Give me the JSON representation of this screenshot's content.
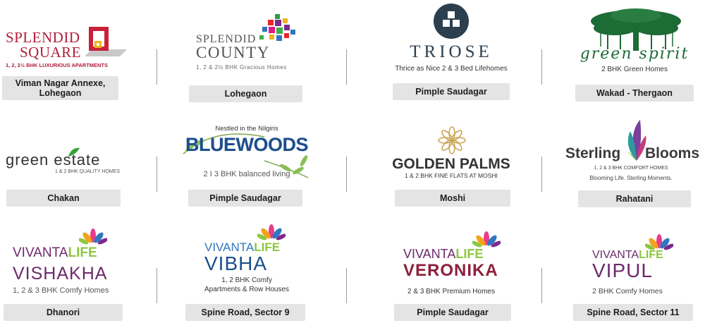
{
  "projects": [
    {
      "name_line1": "SPLENDID",
      "name_line2": "SQUARE",
      "tagline": "1, 2, 2½ BHK LUXURIOUS APARTMENTS",
      "location": "Viman Nagar Annexe, Lohegaon",
      "location_line1": "Viman Nagar Annexe,",
      "location_line2": "Lohegaon"
    },
    {
      "name_line1": "SPLENDID",
      "name_line2": "COUNTY",
      "tagline": "1, 2 & 2½ BHK Gracious Homes",
      "location": "Lohegaon"
    },
    {
      "name": "TRIOSE",
      "tagline": "Thrice as Nice 2 & 3 Bed Lifehomes",
      "location": "Pimple Saudagar"
    },
    {
      "name": "green spirit",
      "tagline": "2 BHK Green Homes",
      "location": "Wakad - Thergaon"
    },
    {
      "name_part1": "green ",
      "name_part2": "estate",
      "tagline": "1 & 2 BHK QUALITY HOMES",
      "location": "Chakan"
    },
    {
      "pretitle": "Nestled in the Nilgiris",
      "name": "BLUEWOODS",
      "tagline": "2 I 3 BHK balanced living",
      "location": "Pimple Saudagar"
    },
    {
      "name": "GOLDEN PALMS",
      "tagline": "1 & 2 BHK FINE FLATS AT MOSHI",
      "location": "Moshi"
    },
    {
      "name_part1": "Sterling",
      "name_part2": "Blooms",
      "tagline": "1, 2 & 3 BHK COMFORT HOMES",
      "subtagline": "Blooming Life. Sterling Moments.",
      "location": "Rahatani"
    },
    {
      "brand_part1": "VIVANTA",
      "brand_part2": "LIFE",
      "name": "VISHAKHA",
      "tagline": "1, 2 & 3 BHK Comfy Homes",
      "location": "Dhanori"
    },
    {
      "brand_part1": "VIVANTA",
      "brand_part2": "LIFE",
      "name": "VIBHA",
      "tagline_line1": "1, 2 BHK Comfy",
      "tagline_line2": "Apartments & Row Houses",
      "location": "Spine Road, Sector 9"
    },
    {
      "brand_part1": "VIVANTA",
      "brand_part2": "LIFE",
      "name": "VERONIKA",
      "tagline": "2 & 3 BHK Premium Homes",
      "location": "Pimple Saudagar"
    },
    {
      "brand_part1": "VIVANTA",
      "brand_part2": "LIFE",
      "name": "VIPUL",
      "tagline": "2 BHK Comfy Homes",
      "location": "Spine Road, Sector 11"
    }
  ],
  "colors": {
    "splendid_red": "#b0203a",
    "county_gray": "#555555",
    "triose_navy": "#2c3f4f",
    "spirit_green": "#1d6b35",
    "bluewoods_blue": "#1e4f8c",
    "palms_gold": "#c9a24a",
    "sterling_gray": "#3b3b3b",
    "vivanta_purple": "#6d2a6b",
    "vivanta_green": "#8cc63f",
    "veronika_maroon": "#8d1f3c",
    "tag_gray": "#e4e4e4"
  },
  "icons": [
    "square-logo-icon",
    "pixel-blocks-icon",
    "triose-diamond-icon",
    "banyan-tree-icon",
    "leaf-icon",
    "leaf-branch-icon",
    "star-flower-icon",
    "feather-bloom-icon",
    "lotus-icon"
  ]
}
